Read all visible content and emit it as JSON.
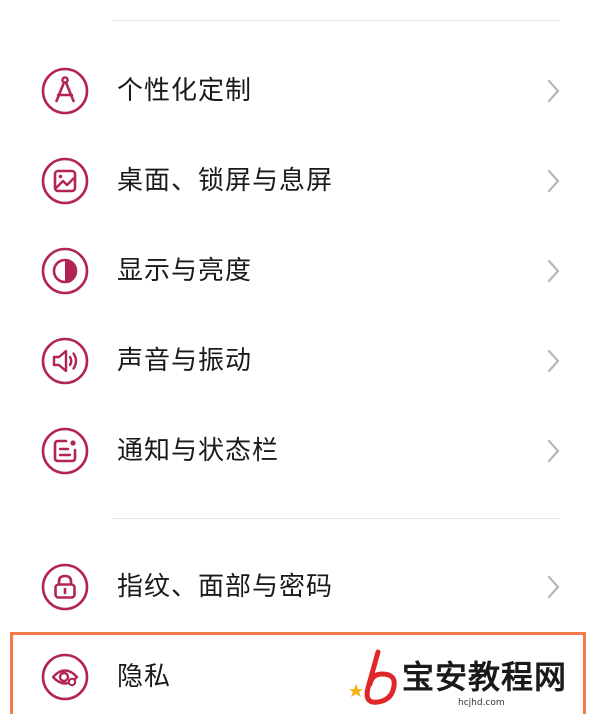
{
  "colors": {
    "accent": "#b22552",
    "chevron": "#b8b8b8",
    "highlight_border": "#f47a4b",
    "watermark_red": "#e0262b"
  },
  "settings": {
    "items": [
      {
        "label": "个性化定制",
        "icon": "compass-icon"
      },
      {
        "label": "桌面、锁屏与息屏",
        "icon": "wallpaper-icon"
      },
      {
        "label": "显示与亮度",
        "icon": "contrast-icon"
      },
      {
        "label": "声音与振动",
        "icon": "speaker-icon"
      },
      {
        "label": "通知与状态栏",
        "icon": "notification-icon"
      },
      {
        "label": "指纹、面部与密码",
        "icon": "lock-icon"
      },
      {
        "label": "隐私",
        "icon": "eye-privacy-icon"
      }
    ]
  },
  "watermark": {
    "text": "宝安教程网",
    "url": "hcjhd.com"
  }
}
